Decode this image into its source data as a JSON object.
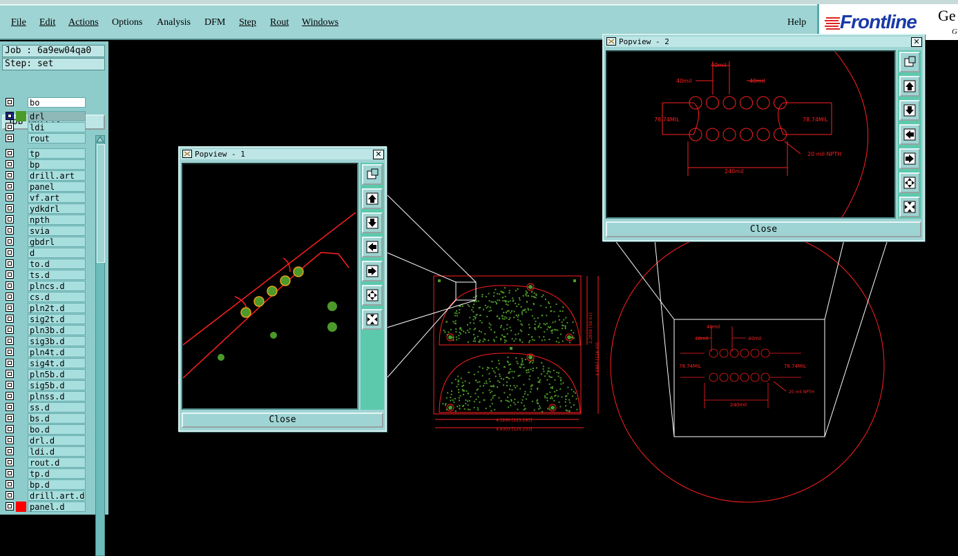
{
  "menu": [
    "File",
    "Edit",
    "Actions",
    "Options",
    "Analysis",
    "DFM",
    "Step",
    "Rout",
    "Windows"
  ],
  "menu_help": "Help",
  "logo": {
    "brand": "Frontline",
    "partial_right": "Ge",
    "partial_sub": "G"
  },
  "job_label": "Job : 6a9ew04qa0",
  "step_label": "Step: set",
  "job_matrix": "Job Matrix ...",
  "layers_board": [
    {
      "name": "bo",
      "color": "",
      "highlighted": false
    },
    {
      "name": "drl",
      "color": "#4c9a2a",
      "highlighted": true
    },
    {
      "name": "ldi",
      "color": "",
      "highlighted": false
    },
    {
      "name": "rout",
      "color": "",
      "highlighted": false
    }
  ],
  "layers": [
    "tp",
    "bp",
    "drill.art",
    "panel",
    "vf.art",
    "ydkdrl",
    "npth",
    "svia",
    "gbdrl",
    "d",
    "to.d",
    "ts.d",
    "plncs.d",
    "cs.d",
    "pln2t.d",
    "sig2t.d",
    "pln3b.d",
    "sig3b.d",
    "pln4t.d",
    "sig4t.d",
    "pln5b.d",
    "sig5b.d",
    "plnss.d",
    "ss.d",
    "bs.d",
    "bo.d",
    "drl.d",
    "ldi.d",
    "rout.d",
    "tp.d",
    "bp.d",
    "drill.art.d",
    "panel.d"
  ],
  "last_layer_color": "#ff0000",
  "popview1": {
    "title": "Popview - 1",
    "close_label": "Close"
  },
  "popview2": {
    "title": "Popview - 2",
    "close_label": "Close",
    "annotations": {
      "top_pitch": "40mil",
      "left_pitch": "40mil",
      "right_pitch": "40mil",
      "left_dim": "78.74MIL",
      "right_dim": "78.74MIL",
      "hole_note": "20 mil  NPTH",
      "bottom_dim": "240mil"
    }
  },
  "board_dims": {
    "width_1": "4.5260 [115.193]",
    "width_2": "4.9303 [125.233]",
    "height_1": "2.2856 [58.01]",
    "height_2": "4.5867 [116.43]"
  },
  "colors": {
    "accent": "#9fd4d4",
    "outline": "#ff2020",
    "pads": "#4c9a2a",
    "background": "#000000"
  }
}
